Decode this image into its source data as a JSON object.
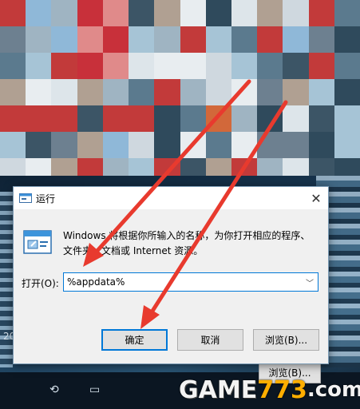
{
  "dialog": {
    "title": "运行",
    "description_line1": "Windows 将根据你所输入的名称，为你打开相应的程序、",
    "description_line2": "文件夹、文档或 Internet 资源。",
    "open_label": "打开(O):",
    "input_value": "%appdata%",
    "ok_label": "确定",
    "cancel_label": "取消",
    "browse_label": "浏览(B)..."
  },
  "background": {
    "partial_label": "20",
    "partial_button": "浏览(B)..."
  },
  "watermark": {
    "part1": "GAME",
    "part2": "773",
    "part3": ".com"
  },
  "colors": {
    "focus_border": "#0078d7",
    "arrow": "#e83a2e",
    "dialog_bg": "#f0f0f0"
  },
  "icons": {
    "title": "run-dialog-icon",
    "close": "close-icon",
    "dropdown": "chevron-down-icon",
    "program": "run-program-icon"
  }
}
